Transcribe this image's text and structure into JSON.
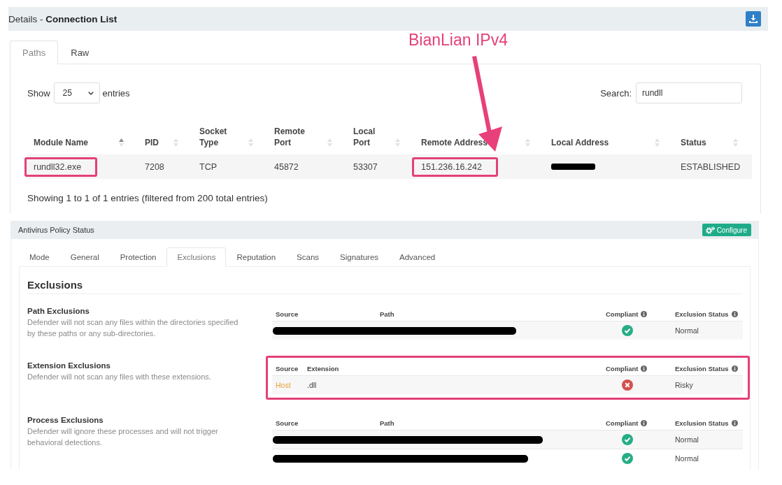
{
  "connection_list": {
    "title": "Details - **Connection List**",
    "tabs": [
      {
        "label": "Paths",
        "selected": true
      },
      {
        "label": "Raw",
        "selected": false
      }
    ],
    "length_menu": {
      "label_before": "Show",
      "value": "25",
      "label_after": "entries"
    },
    "search": {
      "label": "Search:",
      "value": "rundll"
    },
    "table": {
      "columns": [
        {
          "label": "Module Name",
          "sorted_ascending": true
        },
        {
          "label": "PID",
          "sorted_ascending": false
        },
        {
          "label": "Socket Type",
          "sorted_ascending": false
        },
        {
          "label": "Remote Port",
          "sorted_ascending": false
        },
        {
          "label": "Local Port",
          "sorted_ascending": false
        },
        {
          "label": "Remote Address",
          "sorted_ascending": false
        },
        {
          "label": "Local Address",
          "sorted_ascending": false
        },
        {
          "label": "Status",
          "sorted_ascending": false
        }
      ],
      "rows": [
        {
          "cells": [
            {
              "kind": "text",
              "text": "rundll32.exe",
              "highlighted": true
            },
            {
              "kind": "text",
              "text": "7208",
              "highlighted": false
            },
            {
              "kind": "text",
              "text": "TCP",
              "highlighted": false
            },
            {
              "kind": "text",
              "text": "45872",
              "highlighted": false
            },
            {
              "kind": "text",
              "text": "53307",
              "highlighted": false
            },
            {
              "kind": "text",
              "text": "151.236.16.242",
              "highlighted": true
            },
            {
              "kind": "redacted",
              "highlighted": false
            },
            {
              "kind": "text",
              "text": "ESTABLISHED",
              "highlighted": false
            }
          ]
        }
      ]
    },
    "info": "Showing 1 to 1 of 1 entries (filtered from 200 total entries)"
  },
  "annotation": {
    "label": "BianLian IPv4"
  },
  "antivirus_policy": {
    "title": "Antivirus Policy Status",
    "configure_button": "Configure",
    "tabs": [
      {
        "label": "Mode",
        "selected": false
      },
      {
        "label": "General",
        "selected": false
      },
      {
        "label": "Protection",
        "selected": false
      },
      {
        "label": "Exclusions",
        "selected": true
      },
      {
        "label": "Reputation",
        "selected": false
      },
      {
        "label": "Scans",
        "selected": false
      },
      {
        "label": "Signatures",
        "selected": false
      },
      {
        "label": "Advanced",
        "selected": false
      }
    ],
    "heading": "Exclusions",
    "sections": [
      {
        "title": "Path Exclusions",
        "description": "Defender will not scan any files within the directories specified by these paths or any sub-directories.",
        "highlighted": false,
        "columns": [
          {
            "label": "Source",
            "info": false
          },
          {
            "label": "Path",
            "info": false
          },
          {
            "label": "Compliant",
            "info": true
          },
          {
            "label": "Exclusion Status",
            "info": true
          }
        ],
        "rows": [
          {
            "kind": "redacted",
            "compliant": true,
            "exclusion_status": "Normal"
          }
        ]
      },
      {
        "title": "Extension Exclusions",
        "description": "Defender will not scan any files with these extensions.",
        "highlighted": true,
        "columns": [
          {
            "label": "Source",
            "info": false
          },
          {
            "label": "Extension",
            "info": false
          },
          {
            "label": "Compliant",
            "info": true
          },
          {
            "label": "Exclusion Status",
            "info": true
          }
        ],
        "rows": [
          {
            "kind": "text",
            "source": "Host",
            "value": ".dll",
            "compliant": false,
            "exclusion_status": "Risky"
          }
        ]
      },
      {
        "title": "Process Exclusions",
        "description": "Defender will ignore these processes and will not trigger behavioral detections.",
        "highlighted": false,
        "columns": [
          {
            "label": "Source",
            "info": false
          },
          {
            "label": "Path",
            "info": false
          },
          {
            "label": "Compliant",
            "info": true
          },
          {
            "label": "Exclusion Status",
            "info": true
          }
        ],
        "rows": [
          {
            "kind": "redacted",
            "compliant": true,
            "exclusion_status": "Normal"
          },
          {
            "kind": "redacted",
            "compliant": true,
            "exclusion_status": "Normal"
          }
        ]
      }
    ]
  }
}
